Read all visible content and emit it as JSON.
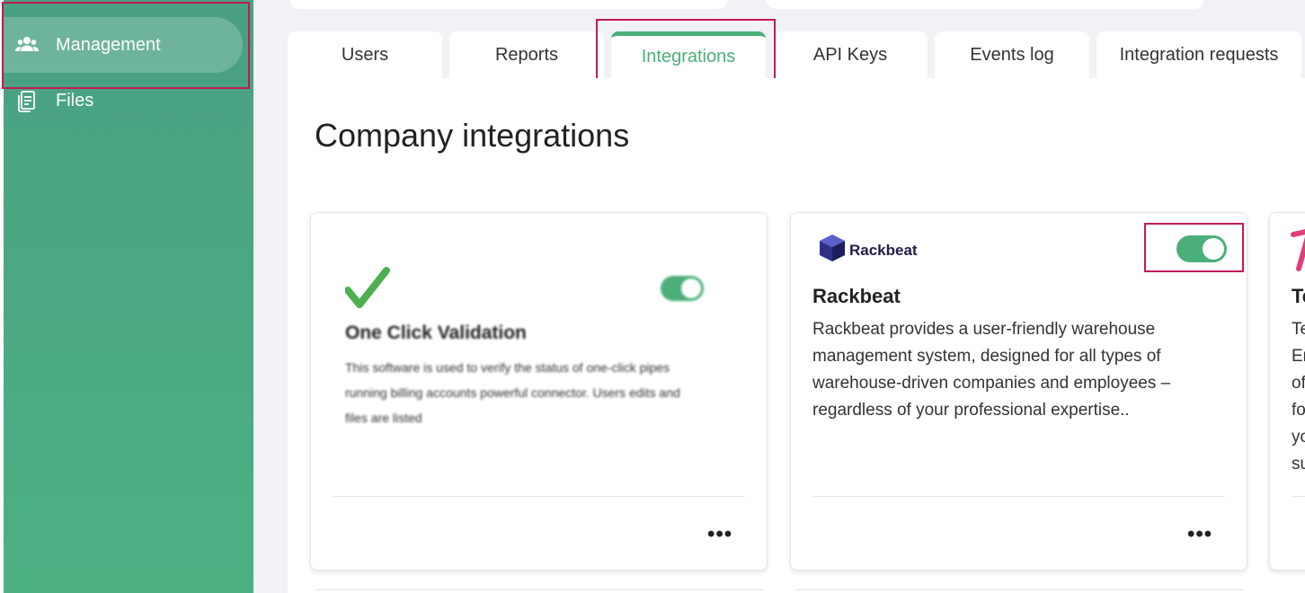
{
  "sidebar": {
    "items": [
      {
        "label": "Management",
        "icon": "people-icon"
      },
      {
        "label": "Files",
        "icon": "files-icon"
      }
    ]
  },
  "tabs": [
    {
      "label": "Users"
    },
    {
      "label": "Reports"
    },
    {
      "label": "Integrations"
    },
    {
      "label": "API Keys"
    },
    {
      "label": "Events log"
    },
    {
      "label": "Integration requests"
    }
  ],
  "main": {
    "title": "Company integrations"
  },
  "cards": [
    {
      "name": "One Click Validation",
      "desc": "This software is used to verify the status of one-click pipes running billing accounts powerful connector. Users edits and files are listed",
      "enabled": true,
      "logo": "checkmark-logo"
    },
    {
      "name": "Rackbeat",
      "logo_text": "Rackbeat",
      "desc": "Rackbeat provides a user-friendly warehouse management system, designed for all types of warehouse-driven companies and employees – regardless of your professional expertise..",
      "enabled": true
    },
    {
      "name": "Te",
      "desc_lines": [
        "Te",
        "Er",
        "of",
        "fo",
        "yo",
        "su"
      ]
    }
  ],
  "more_label": "•••",
  "colors": {
    "accent": "#4caf7a",
    "sidebar": "#4aa082",
    "highlight": "#c2185b"
  }
}
